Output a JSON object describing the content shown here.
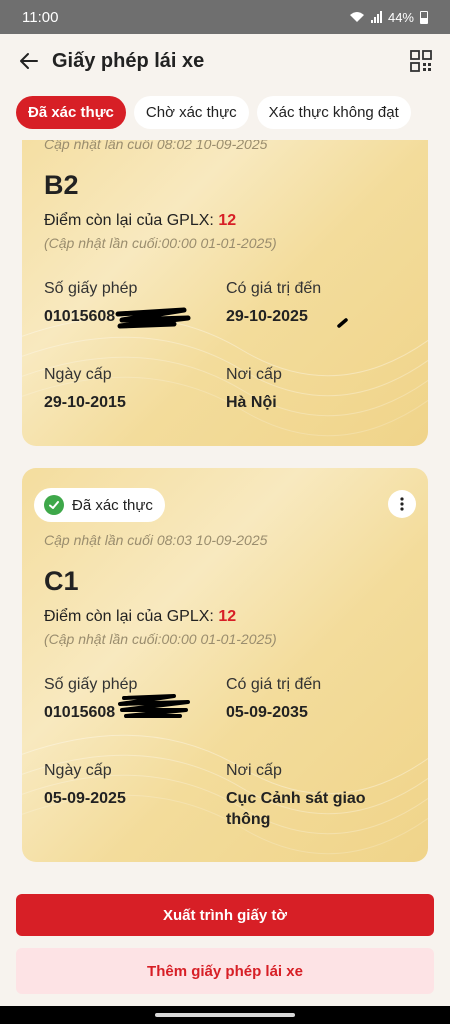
{
  "status_bar": {
    "time": "11:00",
    "battery": "44%"
  },
  "header": {
    "title": "Giấy phép lái xe"
  },
  "tabs": [
    {
      "label": "Đã xác thực",
      "active": true
    },
    {
      "label": "Chờ xác thực",
      "active": false
    },
    {
      "label": "Xác thực không đạt",
      "active": false
    }
  ],
  "cards": [
    {
      "badge": "",
      "updated": "Cập nhật lần cuối 08:02 10-09-2025",
      "class": "B2",
      "points_label": "Điểm còn lại của GPLX:",
      "points": "12",
      "points_updated": "(Cập nhật lần cuối:00:00 01-01-2025)",
      "license_no_label": "Số giấy phép",
      "license_no": "01015608",
      "valid_until_label": "Có giá trị đến",
      "valid_until": "29-10-2025",
      "issue_date_label": "Ngày cấp",
      "issue_date": "29-10-2015",
      "issue_place_label": "Nơi cấp",
      "issue_place": "Hà Nội"
    },
    {
      "badge": "Đã xác thực",
      "updated": "Cập nhật lần cuối 08:03 10-09-2025",
      "class": "C1",
      "points_label": "Điểm còn lại của GPLX:",
      "points": "12",
      "points_updated": "(Cập nhật lần cuối:00:00 01-01-2025)",
      "license_no_label": "Số giấy phép",
      "license_no": "01015608",
      "valid_until_label": "Có giá trị đến",
      "valid_until": "05-09-2035",
      "issue_date_label": "Ngày cấp",
      "issue_date": "05-09-2025",
      "issue_place_label": "Nơi cấp",
      "issue_place": "Cục Cảnh sát giao thông"
    }
  ],
  "buttons": {
    "present": "Xuất trình giấy tờ",
    "add": "Thêm giấy phép lái xe"
  },
  "colors": {
    "accent": "#d71f26",
    "card": "#f4dd9e",
    "verified": "#3ea84a"
  }
}
